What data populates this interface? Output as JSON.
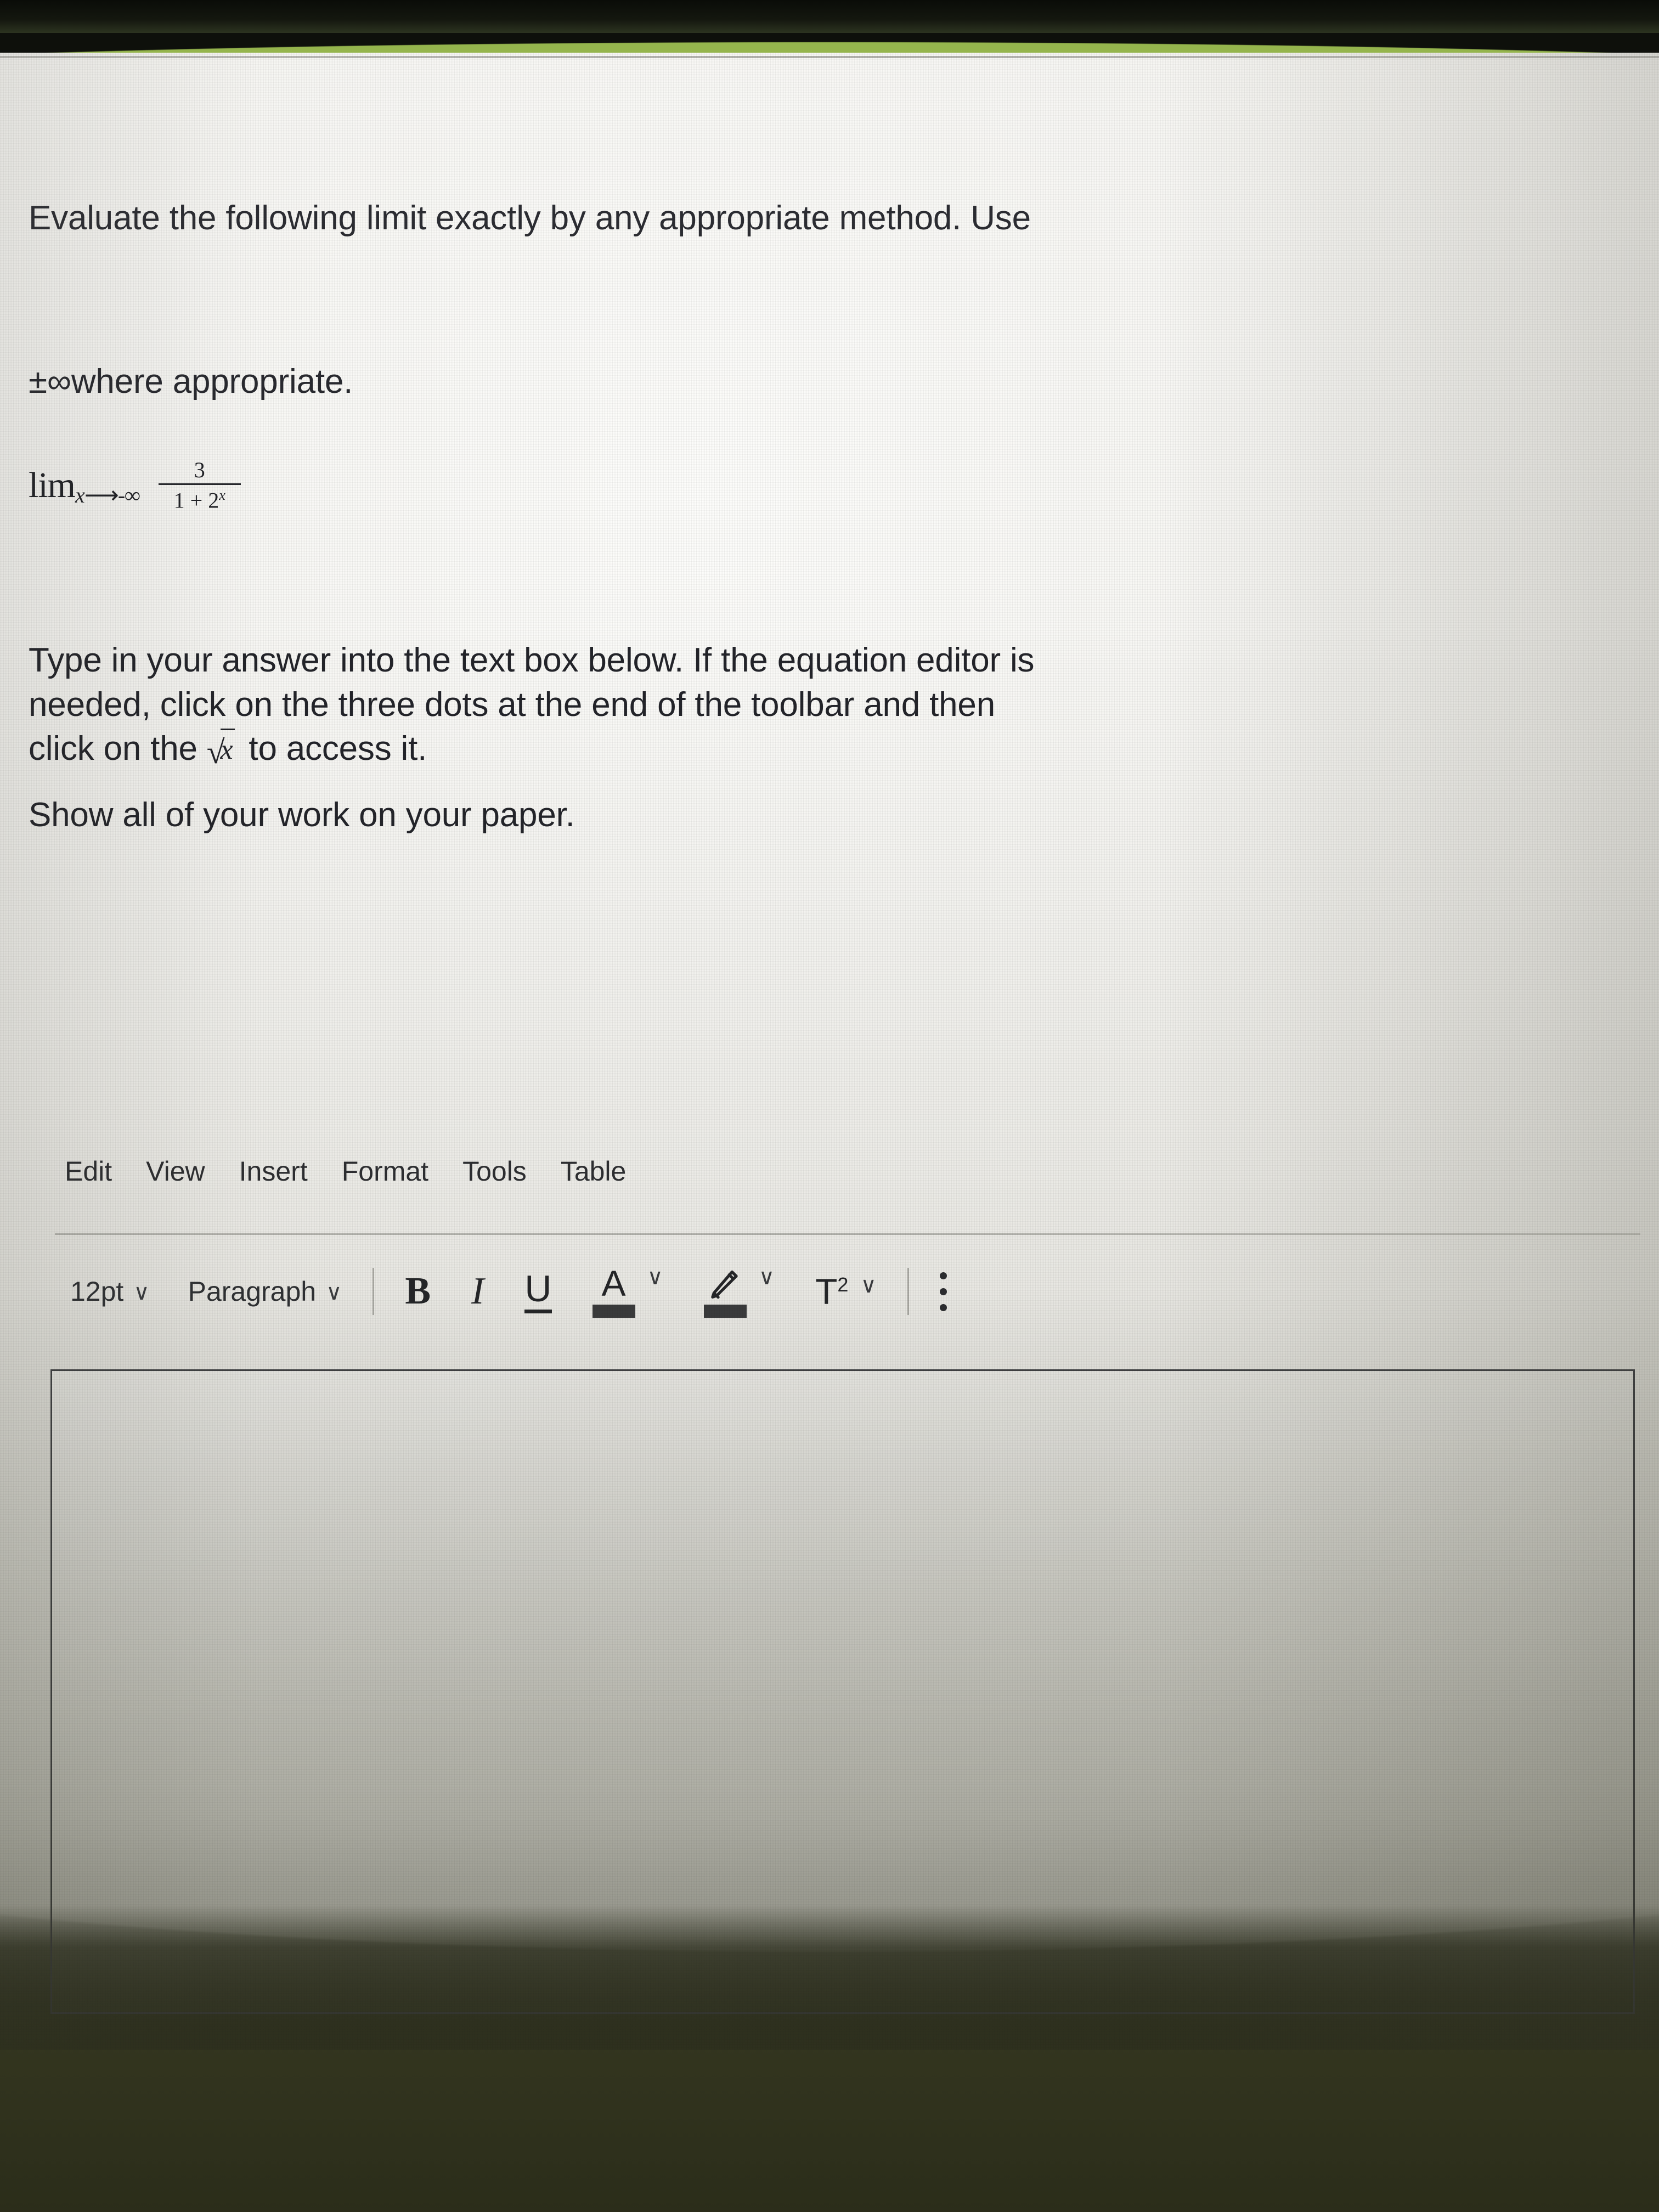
{
  "question": {
    "line1": "Evaluate the following limit exactly by any appropriate method. Use",
    "line2": "±∞where appropriate.",
    "math": {
      "lim_word": "lim",
      "lim_sub_var": "x",
      "arrow": "⟶",
      "limit_point": "-∞",
      "numerator": "3",
      "denominator_base": "1 + 2",
      "denominator_exponent": "x",
      "plain": "lim x⟶-∞  3/(1+2^x)"
    }
  },
  "instructions": {
    "para1_line1": "Type in your answer into the text box below. If the equation editor is",
    "para1_line2": "needed, click on the three dots at the end of the toolbar and then",
    "para1_line3_before": "click on the ",
    "para1_line3_sqrt_radical": "√",
    "para1_line3_sqrt_arg": "x",
    "para1_line3_after": " to access it.",
    "para2": "Show all of your work on your paper."
  },
  "menubar": {
    "items": [
      {
        "label": "Edit",
        "name": "menu-edit"
      },
      {
        "label": "View",
        "name": "menu-view"
      },
      {
        "label": "Insert",
        "name": "menu-insert"
      },
      {
        "label": "Format",
        "name": "menu-format"
      },
      {
        "label": "Tools",
        "name": "menu-tools"
      },
      {
        "label": "Table",
        "name": "menu-table"
      }
    ]
  },
  "toolbar": {
    "font_size_value": "12pt",
    "font_size_caret": "∨",
    "block_format_value": "Paragraph",
    "block_format_caret": "∨",
    "bold_label": "B",
    "italic_label": "I",
    "underline_label": "U",
    "text_color_glyph": "A",
    "text_color_caret": "∨",
    "text_color_swatch": "#3a3b3d",
    "highlight_icon": "highlighter-pen-icon",
    "highlight_caret": "∨",
    "highlight_swatch": "#3a3b3d",
    "superscript_label": "T",
    "superscript_exponent": "2",
    "superscript_caret": "∨",
    "more_options_icon": "vertical-ellipsis-icon"
  },
  "editor": {
    "value": "",
    "placeholder": ""
  },
  "colors": {
    "accent_green": "#95b54d",
    "screen_bg": "#f3f2ee",
    "text": "#23242a",
    "border": "#3f4044",
    "dark_surround": "#2b2d1a"
  }
}
